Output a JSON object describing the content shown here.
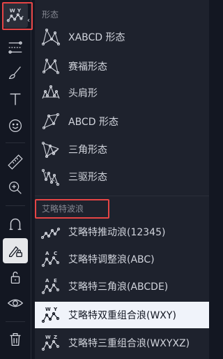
{
  "toolbar": {
    "tools": [
      {
        "name": "wave-pattern-tool",
        "icon": "wxy-wave-icon"
      },
      {
        "name": "fib-tool",
        "icon": "fib-retracement-icon"
      },
      {
        "name": "brush-tool",
        "icon": "brush-icon"
      },
      {
        "name": "text-tool",
        "icon": "text-icon"
      },
      {
        "name": "emoji-tool",
        "icon": "smile-icon"
      },
      {
        "name": "ruler-tool",
        "icon": "ruler-icon"
      },
      {
        "name": "zoom-tool",
        "icon": "zoom-in-icon"
      },
      {
        "name": "magnet-tool",
        "icon": "magnet-icon"
      },
      {
        "name": "lock-drawing-tool",
        "icon": "pencil-lock-icon"
      },
      {
        "name": "lock-all-tool",
        "icon": "unlock-icon"
      },
      {
        "name": "hide-tool",
        "icon": "eye-icon"
      },
      {
        "name": "delete-tool",
        "icon": "trash-icon"
      }
    ],
    "active_letters": "W Y"
  },
  "panel": {
    "section_patterns": "形态",
    "patterns": [
      {
        "label": "XABCD 形态",
        "icon": "xabcd-pattern-icon"
      },
      {
        "label": "赛福形态",
        "icon": "cypher-pattern-icon"
      },
      {
        "label": "头肩形",
        "icon": "head-shoulders-icon"
      },
      {
        "label": "ABCD 形态",
        "icon": "abcd-pattern-icon"
      },
      {
        "label": "三角形态",
        "icon": "triangle-pattern-icon"
      },
      {
        "label": "三驱形态",
        "icon": "three-drives-icon"
      }
    ],
    "section_elliott": "艾略特波浪",
    "elliott": [
      {
        "label": "艾略特推动浪(12345)",
        "icon": "impulse-wave-icon",
        "letters": ""
      },
      {
        "label": "艾略特调整浪(ABC)",
        "icon": "correction-wave-icon",
        "letters": "A C"
      },
      {
        "label": "艾略特三角浪(ABCDE)",
        "icon": "triangle-wave-icon",
        "letters": "A E"
      },
      {
        "label": "艾略特双重组合浪(WXY)",
        "icon": "double-combo-wave-icon",
        "letters": "W Y"
      },
      {
        "label": "艾略特三重组合浪(WXYXZ)",
        "icon": "triple-combo-wave-icon",
        "letters": "W Z"
      }
    ],
    "selected_index": 3
  },
  "colors": {
    "background": "#131722",
    "panel": "#1e222d",
    "highlight": "#e64545",
    "selected_row": "#f0f3fa"
  }
}
